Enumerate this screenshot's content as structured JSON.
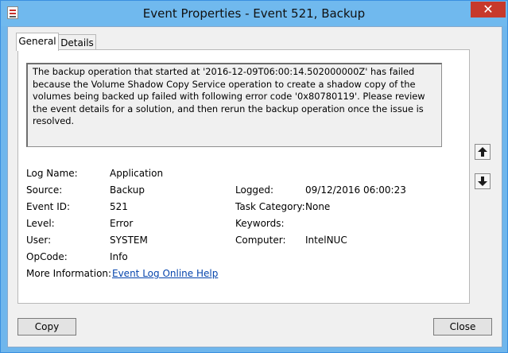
{
  "window": {
    "title": "Event Properties - Event 521, Backup",
    "close_label": "✕"
  },
  "tabs": [
    {
      "label": "General",
      "active": true
    },
    {
      "label": "Details",
      "active": false
    }
  ],
  "event": {
    "description": "The backup operation that started at '2016-12-09T06:00:14.502000000Z' has failed because the Volume Shadow Copy Service operation to create a shadow copy of the volumes being backed up failed with following error code '0x80780119'. Please review the event details for a solution, and then rerun the backup operation once the issue is resolved.",
    "fields": {
      "log_name": {
        "label": "Log Name:",
        "value": "Application"
      },
      "source": {
        "label": "Source:",
        "value": "Backup"
      },
      "event_id": {
        "label": "Event ID:",
        "value": "521"
      },
      "level": {
        "label": "Level:",
        "value": "Error"
      },
      "user": {
        "label": "User:",
        "value": "SYSTEM"
      },
      "opcode": {
        "label": "OpCode:",
        "value": "Info"
      },
      "more_info": {
        "label": "More Information:",
        "link": "Event Log Online Help"
      },
      "logged": {
        "label": "Logged:",
        "value": "09/12/2016 06:00:23"
      },
      "task_category": {
        "label": "Task Category:",
        "value": "None"
      },
      "keywords": {
        "label": "Keywords:",
        "value": ""
      },
      "computer": {
        "label": "Computer:",
        "value": "IntelNUC"
      }
    }
  },
  "buttons": {
    "copy": "Copy",
    "close": "Close"
  },
  "icons": {
    "up": "arrow-up-icon",
    "down": "arrow-down-icon"
  }
}
